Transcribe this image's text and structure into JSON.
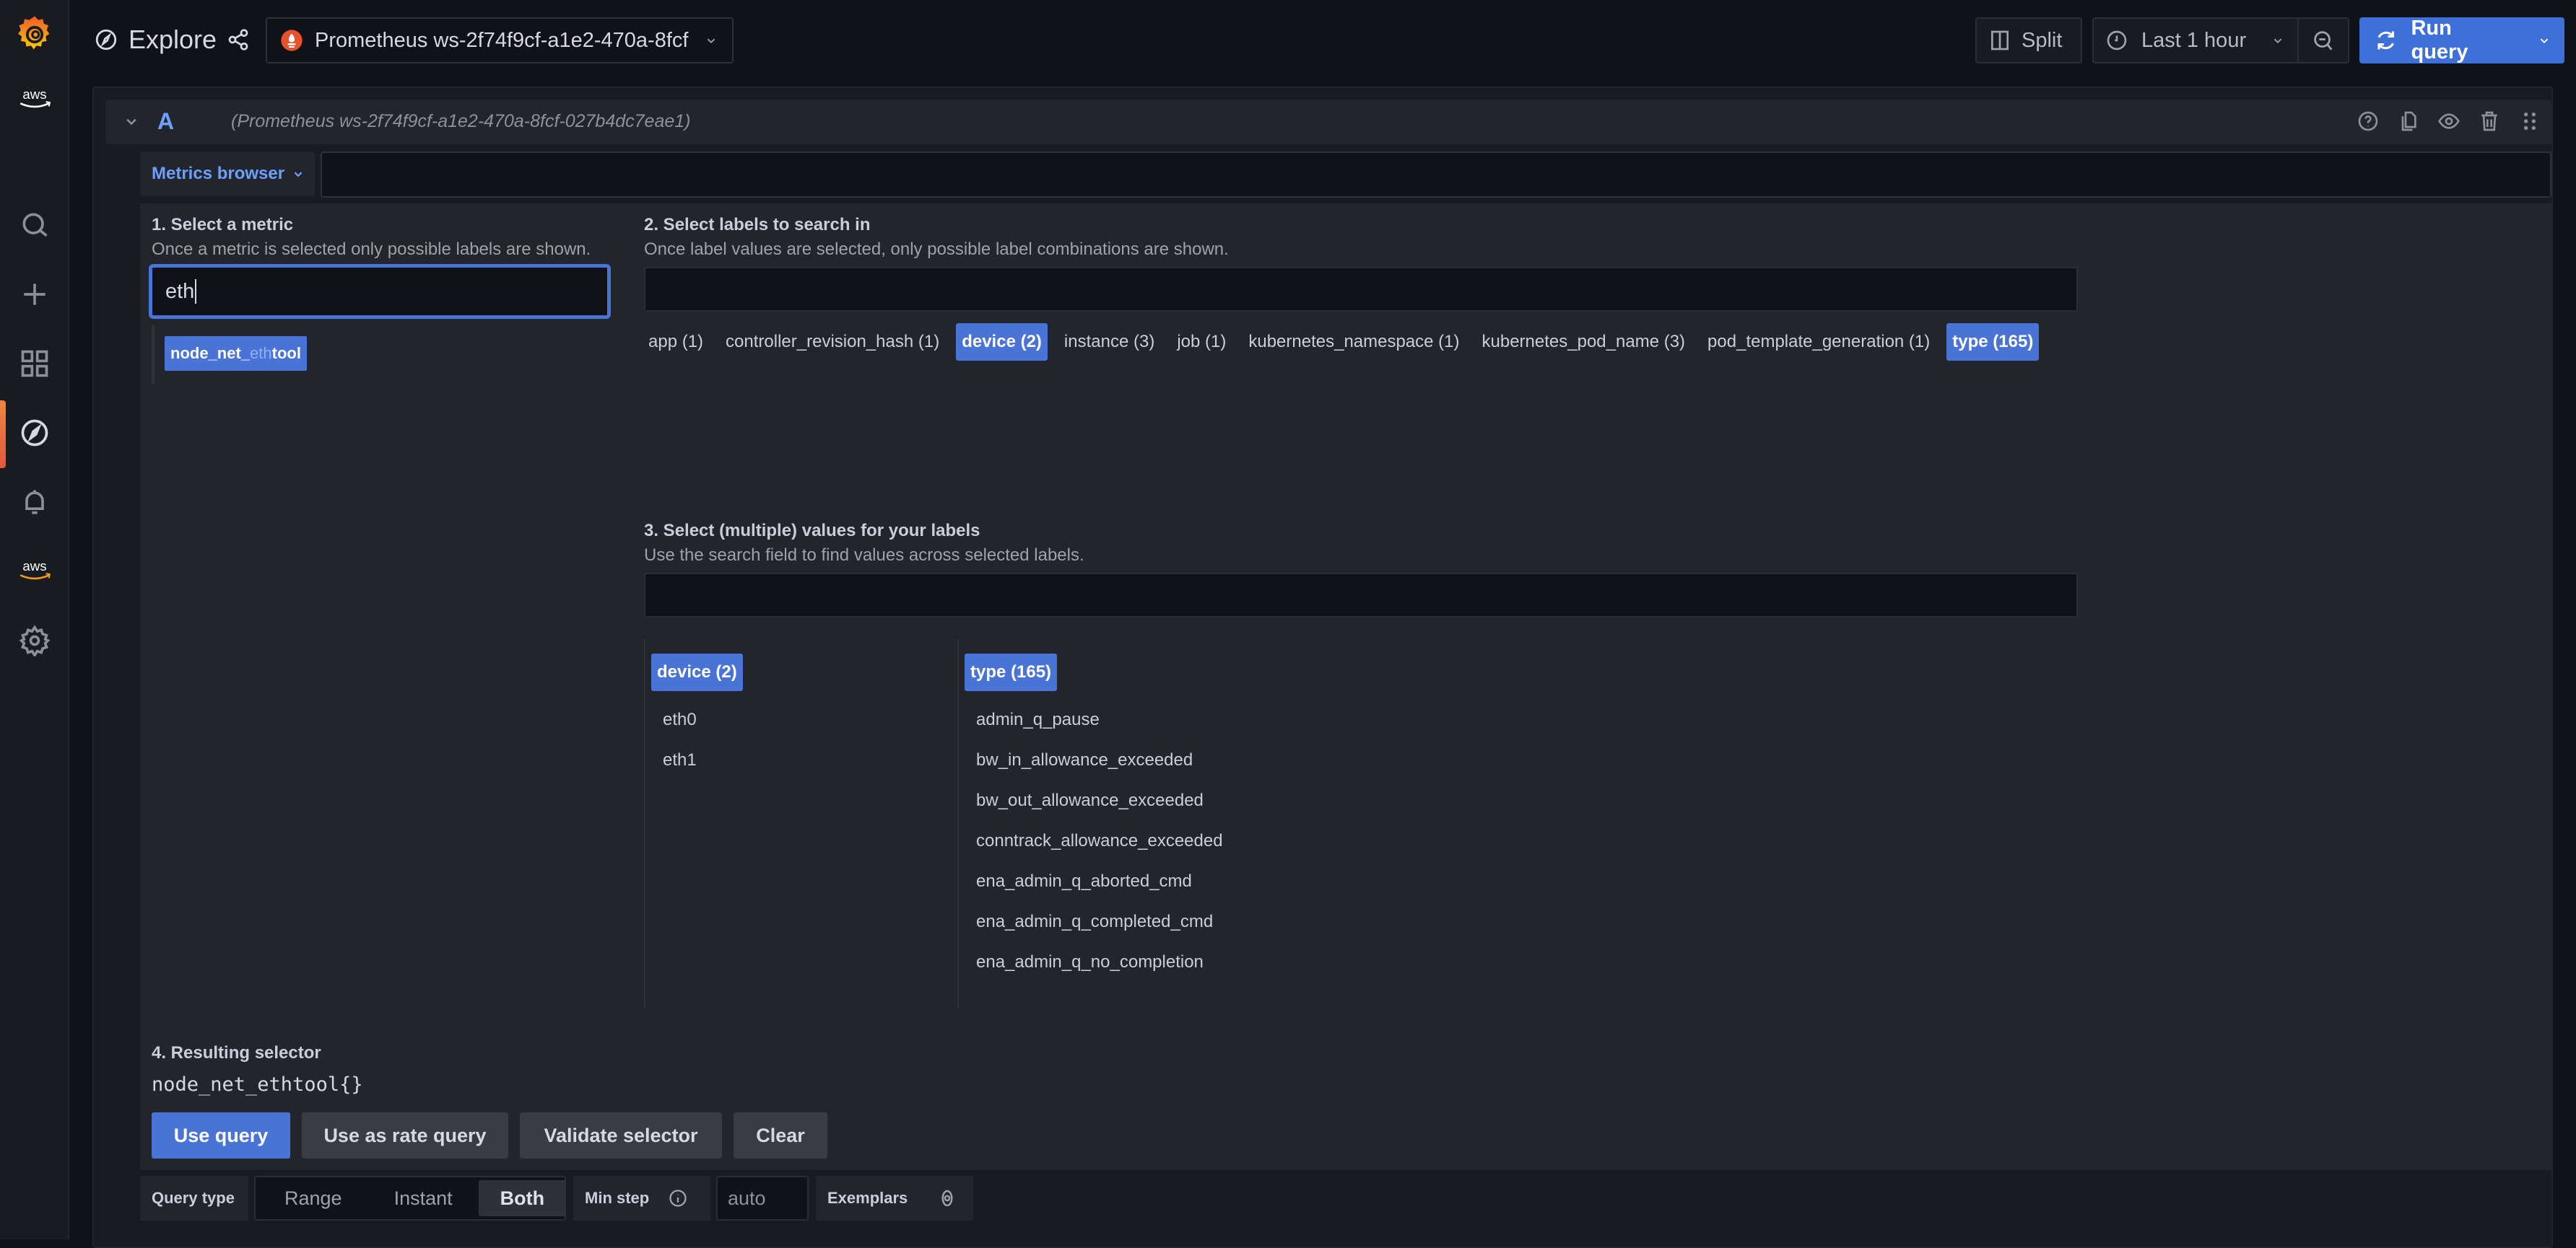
{
  "app": {
    "page_title": "Explore",
    "datasource_name": "Prometheus ws-2f74f9cf-a1e2-470a-8fcf",
    "brand_color": "#f46800",
    "accent_color": "#4a73d6"
  },
  "sidebar": {
    "items": [
      {
        "name": "grafana-logo",
        "icon": "grafana-logo-icon"
      },
      {
        "name": "aws-top",
        "icon": "aws-logo-icon",
        "label": "aws"
      },
      {
        "name": "search",
        "icon": "search-icon"
      },
      {
        "name": "create",
        "icon": "plus-icon"
      },
      {
        "name": "dashboards",
        "icon": "dashboards-grid-icon"
      },
      {
        "name": "explore",
        "icon": "compass-icon",
        "active": true
      },
      {
        "name": "alerting",
        "icon": "bell-icon"
      },
      {
        "name": "aws",
        "icon": "aws-logo-icon",
        "label": "aws"
      },
      {
        "name": "configuration",
        "icon": "gear-icon"
      }
    ]
  },
  "toolbar": {
    "split_label": "Split",
    "time_range_label": "Last 1 hour",
    "run_query_label": "Run query"
  },
  "query": {
    "ref_id": "A",
    "datasource_full": "(Prometheus ws-2f74f9cf-a1e2-470a-8fcf-027b4dc7eae1)",
    "metrics_browser_label": "Metrics browser",
    "editor_value": ""
  },
  "browser": {
    "step1": {
      "title": "1. Select a metric",
      "description": "Once a metric is selected only possible labels are shown.",
      "search_value": "eth",
      "results": [
        {
          "prefix": "node_net_",
          "match": "eth",
          "suffix": "tool",
          "selected": true
        }
      ]
    },
    "step2": {
      "title": "2. Select labels to search in",
      "description": "Once label values are selected, only possible label combinations are shown.",
      "search_value": "",
      "labels": [
        {
          "label": "app (1)",
          "selected": false
        },
        {
          "label": "controller_revision_hash (1)",
          "selected": false
        },
        {
          "label": "device (2)",
          "selected": true
        },
        {
          "label": "instance (3)",
          "selected": false
        },
        {
          "label": "job (1)",
          "selected": false
        },
        {
          "label": "kubernetes_namespace (1)",
          "selected": false
        },
        {
          "label": "kubernetes_pod_name (3)",
          "selected": false
        },
        {
          "label": "pod_template_generation (1)",
          "selected": false
        },
        {
          "label": "type (165)",
          "selected": true
        }
      ]
    },
    "step3": {
      "title": "3. Select (multiple) values for your labels",
      "description": "Use the search field to find values across selected labels.",
      "search_value": "",
      "columns": [
        {
          "header": "device (2)",
          "values": [
            "eth0",
            "eth1"
          ]
        },
        {
          "header": "type (165)",
          "values": [
            "admin_q_pause",
            "bw_in_allowance_exceeded",
            "bw_out_allowance_exceeded",
            "conntrack_allowance_exceeded",
            "ena_admin_q_aborted_cmd",
            "ena_admin_q_completed_cmd",
            "ena_admin_q_no_completion"
          ]
        }
      ]
    },
    "step4": {
      "title": "4. Resulting selector",
      "selector": "node_net_ethtool{}"
    },
    "actions": {
      "use_query": "Use query",
      "use_rate_query": "Use as rate query",
      "validate": "Validate selector",
      "clear": "Clear"
    }
  },
  "options": {
    "query_type_label": "Query type",
    "query_types": [
      "Range",
      "Instant",
      "Both"
    ],
    "query_type_selected": "Both",
    "min_step_label": "Min step",
    "min_step_placeholder": "auto",
    "exemplars_label": "Exemplars"
  }
}
